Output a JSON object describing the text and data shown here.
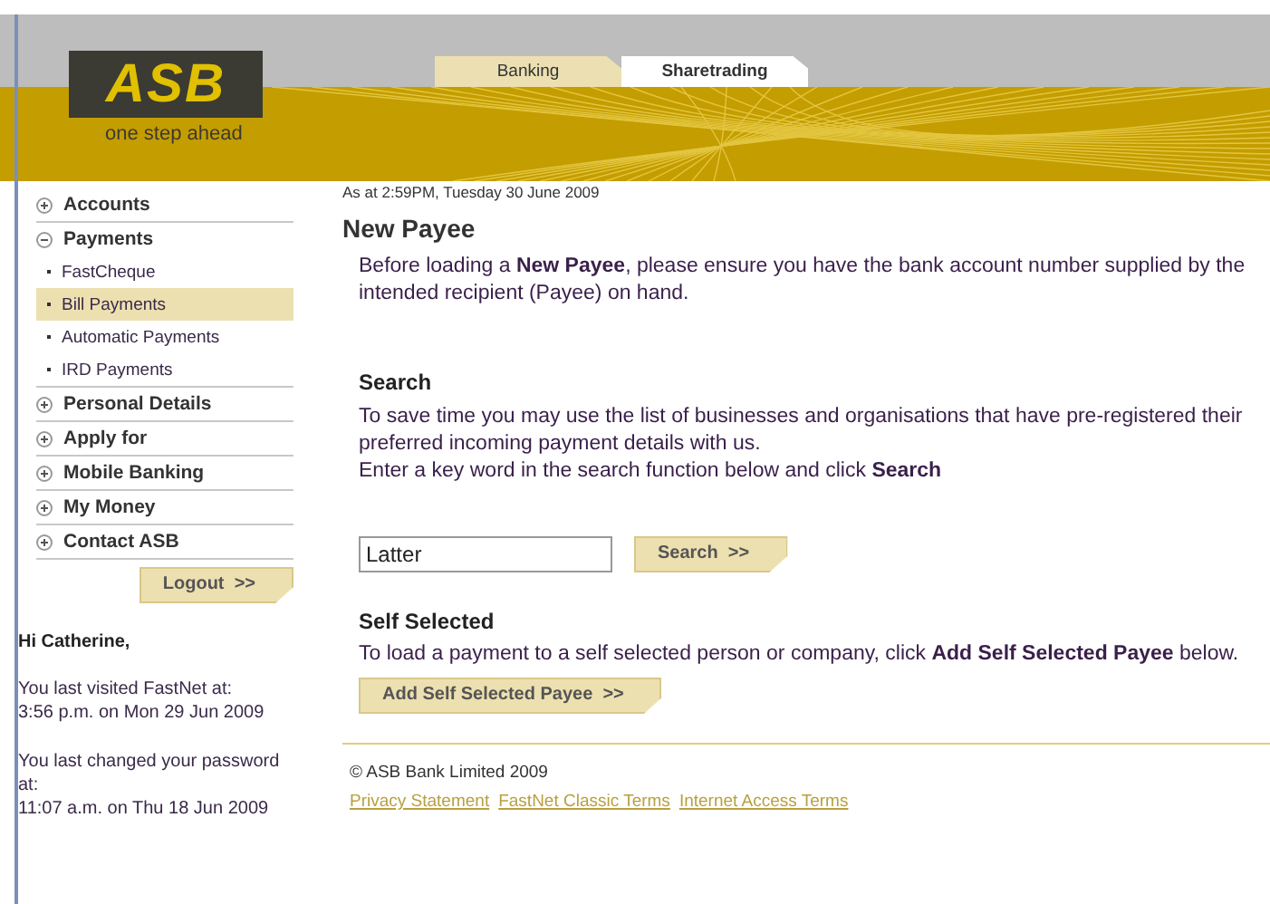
{
  "header": {
    "logo": "ASB",
    "tagline": "one step ahead"
  },
  "tabs": [
    {
      "label": "Banking",
      "selected": false
    },
    {
      "label": "Sharetrading",
      "selected": true
    }
  ],
  "sidebar": {
    "items": [
      {
        "label": "Accounts",
        "expanded": false
      },
      {
        "label": "Payments",
        "expanded": true,
        "children": [
          {
            "label": "FastCheque",
            "selected": false
          },
          {
            "label": "Bill Payments",
            "selected": true
          },
          {
            "label": "Automatic Payments",
            "selected": false
          },
          {
            "label": "IRD Payments",
            "selected": false
          }
        ]
      },
      {
        "label": "Personal Details",
        "expanded": false
      },
      {
        "label": "Apply for",
        "expanded": false
      },
      {
        "label": "Mobile Banking",
        "expanded": false
      },
      {
        "label": "My Money",
        "expanded": false
      },
      {
        "label": "Contact ASB",
        "expanded": false
      }
    ],
    "logout": "Logout  >>",
    "greeting": "Hi Catherine,",
    "last_visited": [
      "You last visited FastNet at:",
      "3:56 p.m. on Mon 29 Jun 2009"
    ],
    "password_changed": [
      "You last changed your password at:",
      "11:07 a.m. on Thu 18 Jun 2009"
    ]
  },
  "main": {
    "timestamp": "As at 2:59PM, Tuesday 30 June 2009",
    "title": "New Payee",
    "intro": "Before loading a **New Payee**, please ensure you have the bank account number supplied by the intended recipient (Payee) on hand.",
    "search": {
      "heading": "Search",
      "text": [
        "To save time you may use the list of businesses and organisations that have pre-registered their preferred incoming payment details with us.",
        "Enter a key word in the search function below and click **Search**"
      ],
      "value": "Latter",
      "button": "Search  >>"
    },
    "self_selected": {
      "heading": "Self Selected",
      "text": "To load a payment to a self selected person or company, click **Add Self Selected Payee** below.",
      "button": "Add Self Selected Payee  >>"
    }
  },
  "footer": {
    "copyright": "© ASB Bank Limited 2009",
    "links": [
      "Privacy Statement",
      "FastNet Classic Terms",
      "Internet Access Terms"
    ]
  }
}
